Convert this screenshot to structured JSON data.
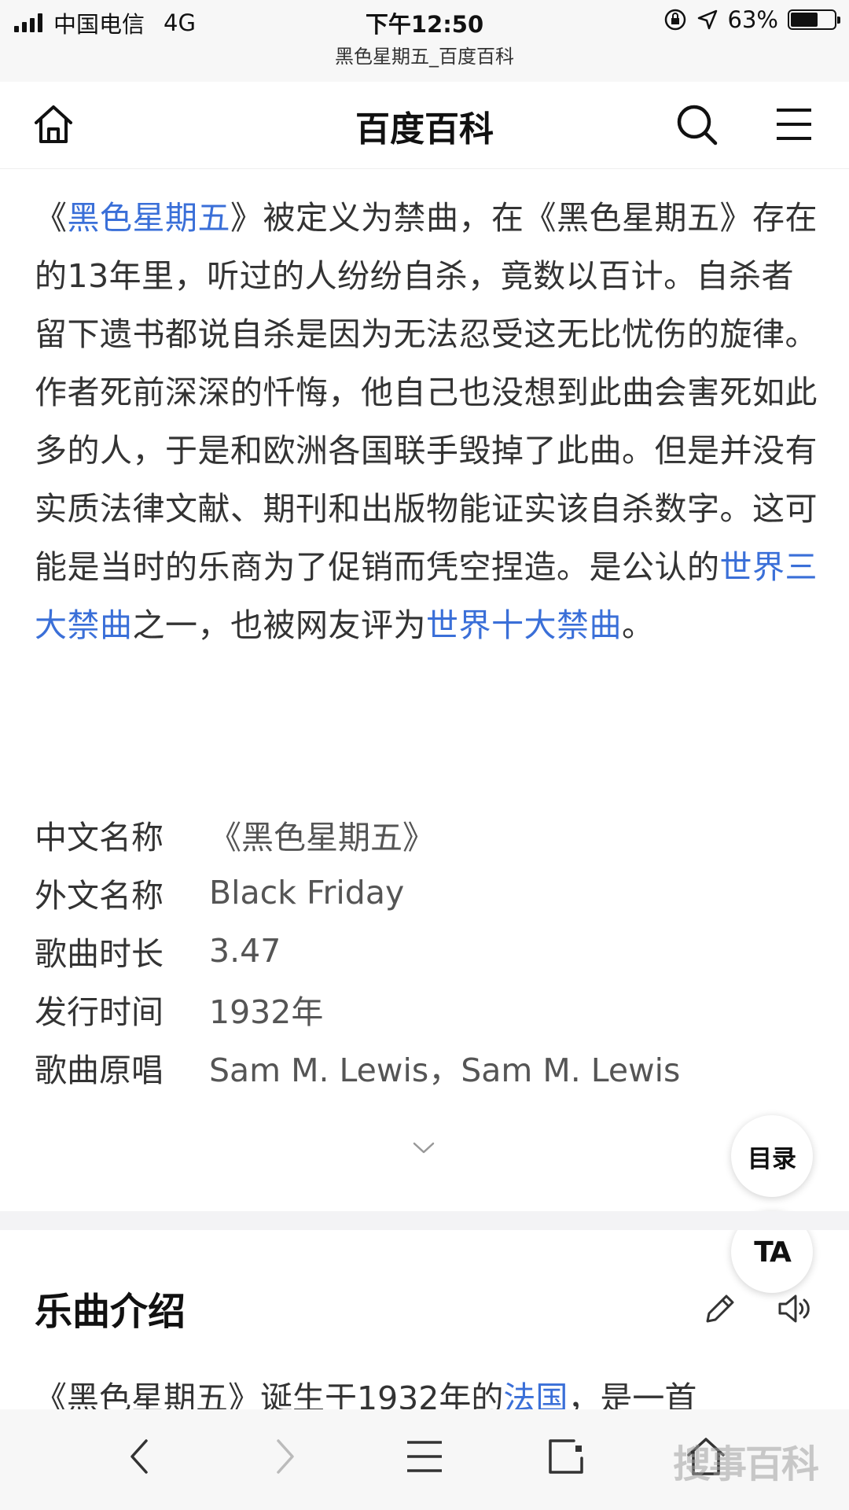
{
  "status_bar": {
    "carrier": "中国电信",
    "network": "4G",
    "time": "下午12:50",
    "page_title": "黑色星期五_百度百科",
    "battery_percent": "63%",
    "battery_level": 0.63
  },
  "nav": {
    "title": "百度百科",
    "home_icon": "home-icon",
    "search_icon": "search-icon",
    "menu_icon": "menu-icon"
  },
  "intro": {
    "p1": "《",
    "link_song": "黑色星期五",
    "p2": "》被定义为禁曲，在《黑色星期五》存在的13年里，听过的人纷纷自杀，竟数以百计。自杀者留下遗书都说自杀是因为无法忍受这无比忧伤的旋律。作者死前深深的忏悔，他自己也没想到此曲会害死如此多的人，于是和欧洲各国联手毁掉了此曲。但是并没有实质法律文献、期刊和出版物能证实该自杀数字。这可能是当时的乐商为了促销而凭空捏造。是公认的",
    "link_three": "世界三大禁曲",
    "p3": "之一，也被网友评为",
    "link_ten": "世界十大禁曲",
    "p4": "。"
  },
  "info_box": [
    {
      "label": "中文名称",
      "value": "《黑色星期五》"
    },
    {
      "label": "外文名称",
      "value": "Black Friday"
    },
    {
      "label": "歌曲时长",
      "value": "3.47"
    },
    {
      "label": "发行时间",
      "value": "1932年"
    },
    {
      "label": "歌曲原唱",
      "value": "Sam M. Lewis，Sam M. Lewis"
    }
  ],
  "fab": {
    "toc_label": "目录",
    "font_label": "TA"
  },
  "section": {
    "title": "乐曲介绍",
    "text_a": "《黑色星期五》诞生于1932年的",
    "link_france": "法国",
    "text_b": "，是一首"
  },
  "toolbar": {
    "back_icon": "chevron-left-icon",
    "forward_icon": "chevron-right-icon",
    "menu_icon": "menu-icon",
    "tabs_icon": "tabs-icon",
    "home_icon": "home-icon",
    "watermark": "搜事百科"
  },
  "colors": {
    "link": "#3a6fd8",
    "text": "#333333",
    "label": "#333333"
  }
}
